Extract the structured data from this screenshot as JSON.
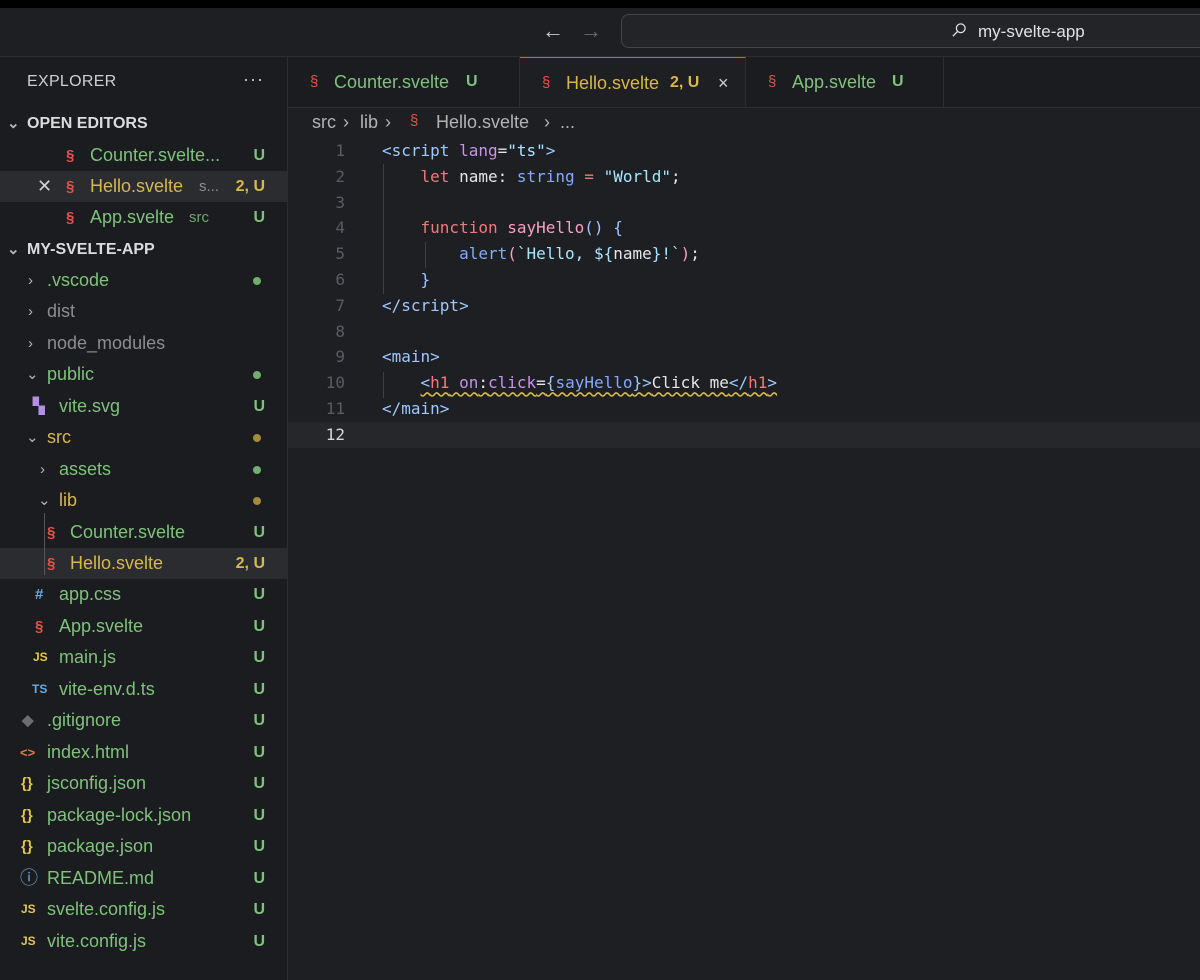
{
  "window": {
    "search_text": "my-svelte-app",
    "nav_back": "←",
    "nav_forward": "→"
  },
  "sidebar": {
    "title": "EXPLORER",
    "more": "···",
    "open_editors_label": "OPEN EDITORS",
    "project_label": "MY-SVELTE-APP",
    "open_editors": [
      {
        "name": "Counter.svelte...",
        "hint": "",
        "status": "U"
      },
      {
        "name": "Hello.svelte",
        "hint": "s...",
        "status": "2, U"
      },
      {
        "name": "App.svelte",
        "hint": "src",
        "status": "U"
      }
    ],
    "tree": [
      {
        "name": ".vscode",
        "status": "dot-green"
      },
      {
        "name": "dist",
        "status": ""
      },
      {
        "name": "node_modules",
        "status": ""
      },
      {
        "name": "public",
        "status": "dot-green"
      },
      {
        "name": "vite.svg",
        "status": "U"
      },
      {
        "name": "src",
        "status": "dot-yellow"
      },
      {
        "name": "assets",
        "status": "dot-green"
      },
      {
        "name": "lib",
        "status": "dot-yellow"
      },
      {
        "name": "Counter.svelte",
        "status": "U"
      },
      {
        "name": "Hello.svelte",
        "status": "2, U"
      },
      {
        "name": "app.css",
        "status": "U"
      },
      {
        "name": "App.svelte",
        "status": "U"
      },
      {
        "name": "main.js",
        "status": "U"
      },
      {
        "name": "vite-env.d.ts",
        "status": "U"
      },
      {
        "name": ".gitignore",
        "status": "U"
      },
      {
        "name": "index.html",
        "status": "U"
      },
      {
        "name": "jsconfig.json",
        "status": "U"
      },
      {
        "name": "package-lock.json",
        "status": "U"
      },
      {
        "name": "package.json",
        "status": "U"
      },
      {
        "name": "README.md",
        "status": "U"
      },
      {
        "name": "svelte.config.js",
        "status": "U"
      },
      {
        "name": "vite.config.js",
        "status": "U"
      }
    ],
    "icons": {
      "svelte": "§",
      "js": "JS",
      "ts": "TS",
      "css": "#",
      "json": "{}",
      "html": "<>",
      "info": "ⓘ",
      "git": "◆",
      "vite": "▚"
    }
  },
  "tabs": [
    {
      "name": "Counter.svelte",
      "status": "U"
    },
    {
      "name": "Hello.svelte",
      "status": "2, U",
      "close": "×"
    },
    {
      "name": "App.svelte",
      "status": "U"
    }
  ],
  "breadcrumb": {
    "parts": [
      "src",
      "lib",
      "Hello.svelte",
      "..."
    ],
    "sep": "›"
  },
  "editor": {
    "line_numbers": [
      "1",
      "2",
      "3",
      "4",
      "5",
      "6",
      "7",
      "8",
      "9",
      "10",
      "11",
      "12"
    ],
    "lines": [
      [
        [
          "<",
          "tag"
        ],
        [
          "script",
          "tag"
        ],
        [
          " ",
          "var"
        ],
        [
          "lang",
          "attr"
        ],
        [
          "=",
          "var"
        ],
        [
          "\"ts\"",
          "str"
        ],
        [
          ">",
          "tag"
        ]
      ],
      [
        [
          "    ",
          "var"
        ],
        [
          "let",
          "kw"
        ],
        [
          " name",
          "var"
        ],
        [
          ": ",
          "var"
        ],
        [
          "string",
          "type"
        ],
        [
          " = ",
          "kw"
        ],
        [
          "\"World\"",
          "str"
        ],
        [
          ";",
          "var"
        ]
      ],
      [],
      [
        [
          "    ",
          "var"
        ],
        [
          "function",
          "kw"
        ],
        [
          " ",
          "var"
        ],
        [
          "sayHello",
          "fn"
        ],
        [
          "() ",
          "brace"
        ],
        [
          "{",
          "brace"
        ]
      ],
      [
        [
          "        ",
          "var"
        ],
        [
          "alert",
          "type"
        ],
        [
          "(",
          "fn"
        ],
        [
          "`Hello, ",
          "str"
        ],
        [
          "${",
          "str"
        ],
        [
          "name",
          "var"
        ],
        [
          "}",
          "str"
        ],
        [
          "!`",
          "str"
        ],
        [
          ")",
          "fn"
        ],
        [
          ";",
          "var"
        ]
      ],
      [
        [
          "    ",
          "var"
        ],
        [
          "}",
          "brace"
        ]
      ],
      [
        [
          "</",
          "tag"
        ],
        [
          "script",
          "tag"
        ],
        [
          ">",
          "tag"
        ]
      ],
      [],
      [
        [
          "<",
          "tag"
        ],
        [
          "main",
          "tag"
        ],
        [
          ">",
          "tag"
        ]
      ],
      [
        [
          "    ",
          "var"
        ],
        [
          "<h1 on:click={sayHello}>Click me</h1>",
          "squig"
        ]
      ],
      [
        [
          "</",
          "tag"
        ],
        [
          "main",
          "tag"
        ],
        [
          ">",
          "tag"
        ]
      ],
      []
    ]
  },
  "colors": {
    "svelte": "#e8524a",
    "untracked": "#7ec27b",
    "modified": "#d8b74d"
  }
}
